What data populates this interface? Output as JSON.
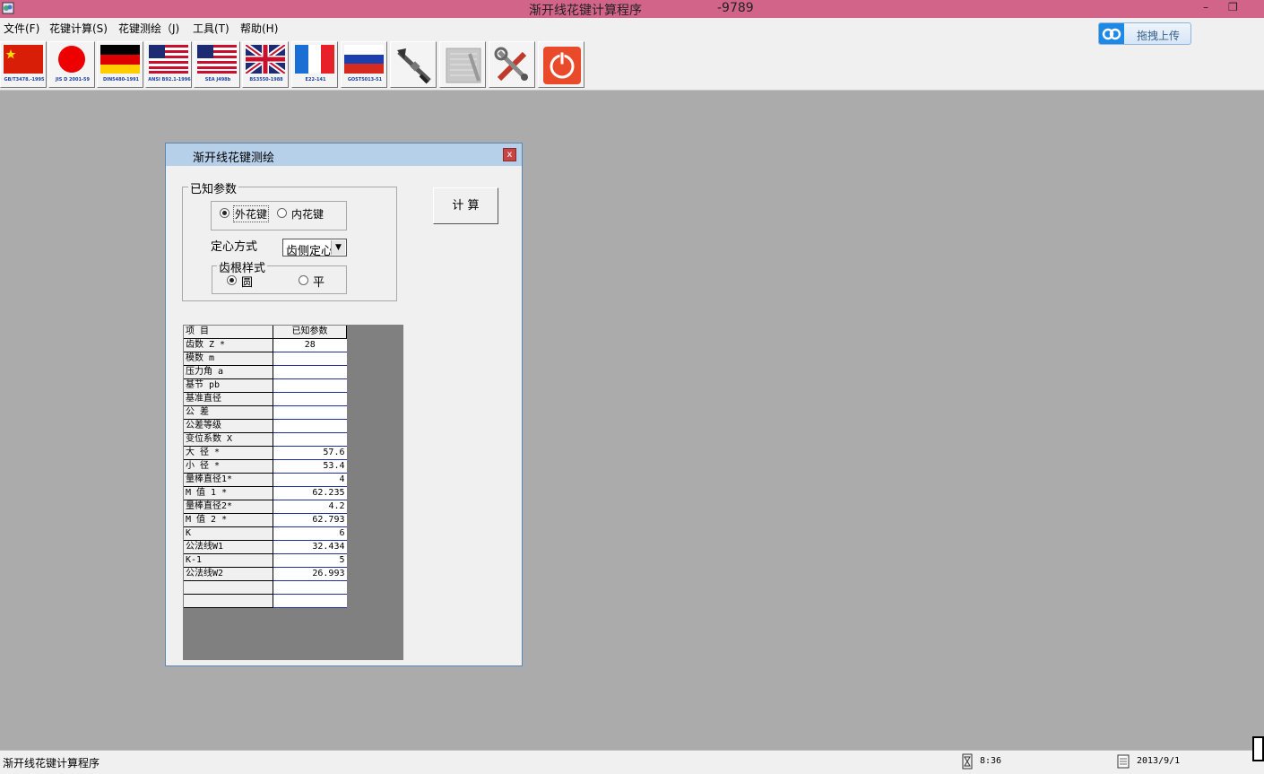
{
  "window": {
    "title": "渐开线花键计算程序",
    "title_code": "-9789",
    "minimize": "–",
    "restore": "❐"
  },
  "menu": [
    {
      "label": "文件(F)"
    },
    {
      "label": "花键计算(S)"
    },
    {
      "label": "花键测绘（J)"
    },
    {
      "label": "工具(T)"
    },
    {
      "label": "帮助(H)"
    }
  ],
  "upload": {
    "label": "拖拽上传",
    "icon": "cloud-upload-icon"
  },
  "toolbar": {
    "standards": [
      {
        "label": "GB/T3478.-1995",
        "icon": "china-flag-icon"
      },
      {
        "label": "JIS D 2001-59",
        "icon": "japan-flag-icon"
      },
      {
        "label": "DIN5480-1991",
        "icon": "germany-flag-icon"
      },
      {
        "label": "ANSI B92.1-1996",
        "icon": "usa-flag-icon"
      },
      {
        "label": "SEA J498b",
        "icon": "usa-flag-icon"
      },
      {
        "label": "BS3550-1988",
        "icon": "uk-flag-icon"
      },
      {
        "label": "E22-141",
        "icon": "france-flag-icon"
      },
      {
        "label": "GOST5013-51",
        "icon": "russia-flag-icon"
      }
    ],
    "tools": [
      {
        "name": "caliper-tool",
        "icon": "caliper-icon"
      },
      {
        "name": "disabled-tool",
        "icon": "grid-disabled-icon"
      },
      {
        "name": "settings-tool",
        "icon": "wrench-screwdriver-icon"
      },
      {
        "name": "exit-tool",
        "icon": "power-icon"
      }
    ]
  },
  "dialog": {
    "title": "渐开线花键测绘",
    "close": "x",
    "known_group": "已知参数",
    "spline_type": {
      "external": "外花键",
      "internal": "内花键",
      "selected": "external"
    },
    "centering_label": "定心方式",
    "centering_value": "齿侧定心",
    "root_group": "齿根样式",
    "root": {
      "round": "圆",
      "flat": "平",
      "selected": "round"
    },
    "calc_button": "计 算",
    "grid": {
      "headers": [
        "项    目",
        "已知参数"
      ],
      "rows": [
        {
          "label": "齿数 Z *",
          "value": "28"
        },
        {
          "label": "模数   m",
          "value": ""
        },
        {
          "label": "压力角 a",
          "value": ""
        },
        {
          "label": "基节  pb",
          "value": ""
        },
        {
          "label": "基准直径",
          "value": ""
        },
        {
          "label": "公    差",
          "value": ""
        },
        {
          "label": "公差等级",
          "value": ""
        },
        {
          "label": "变位系数 X",
          "value": ""
        },
        {
          "label": "大  径 *",
          "value": "57.6"
        },
        {
          "label": "小  径 *",
          "value": "53.4"
        },
        {
          "label": "量棒直径1*",
          "value": "4"
        },
        {
          "label": "M 值 1   *",
          "value": "62.235"
        },
        {
          "label": "量棒直径2*",
          "value": "4.2"
        },
        {
          "label": "M 值 2  *",
          "value": "62.793"
        },
        {
          "label": "K",
          "value": "6"
        },
        {
          "label": "公法线W1",
          "value": "32.434"
        },
        {
          "label": "K-1",
          "value": "5"
        },
        {
          "label": "公法线W2",
          "value": "26.993"
        },
        {
          "label": "",
          "value": ""
        },
        {
          "label": "",
          "value": ""
        }
      ]
    }
  },
  "status": {
    "text": "渐开线花键计算程序",
    "time": "8:36",
    "date": "2013/9/1"
  }
}
